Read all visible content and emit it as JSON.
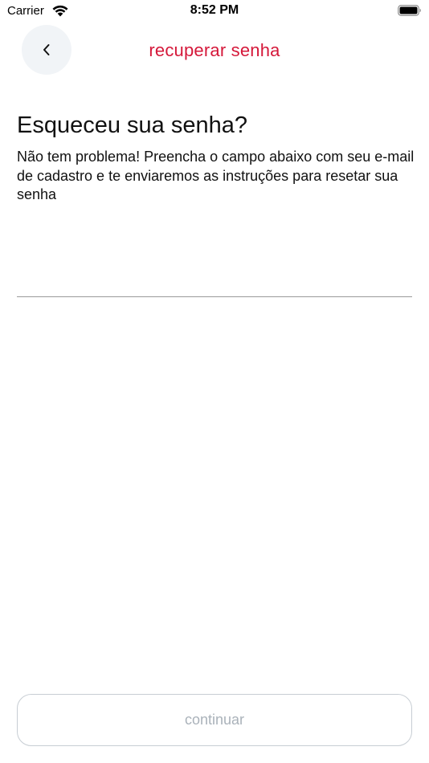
{
  "status_bar": {
    "carrier": "Carrier",
    "time": "8:52 PM",
    "wifi_icon": "wifi-icon",
    "battery_icon": "battery-full-icon"
  },
  "header": {
    "back_icon": "chevron-left-icon",
    "title": "recuperar senha"
  },
  "main": {
    "heading": "Esqueceu sua senha?",
    "description": "Não tem problema! Preencha o campo abaixo com seu e-mail de cadastro e te enviaremos as instruções para resetar sua senha",
    "email_field": {
      "value": "",
      "placeholder": ""
    }
  },
  "footer": {
    "continue_label": "continuar"
  },
  "colors": {
    "accent": "#d5183a",
    "back_button_bg": "#f1f4f7",
    "disabled_text": "#aab2ba",
    "disabled_border": "#c7cdd3"
  }
}
